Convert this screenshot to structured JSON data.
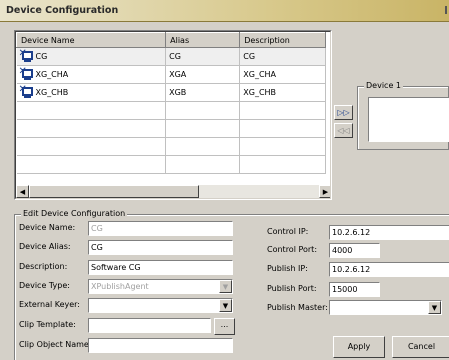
{
  "window": {
    "title": "Device Configuration"
  },
  "device_table": {
    "columns": [
      "Device Name",
      "Alias",
      "Description"
    ],
    "rows": [
      {
        "name": "CG",
        "alias": "CG",
        "description": "CG"
      },
      {
        "name": "XG_CHA",
        "alias": "XGA",
        "description": "XG_CHA"
      },
      {
        "name": "XG_CHB",
        "alias": "XGB",
        "description": "XG_CHB"
      }
    ]
  },
  "transfer": {
    "add_glyph": "▷▷",
    "remove_glyph": "◁◁"
  },
  "device1": {
    "label": "Device 1"
  },
  "edit": {
    "group_label": "Edit Device Configuration",
    "device_name_label": "Device Name:",
    "device_name_value": "CG",
    "device_alias_label": "Device Alias:",
    "device_alias_value": "CG",
    "description_label": "Description:",
    "description_value": "Software CG",
    "device_type_label": "Device Type:",
    "device_type_value": "XPublishAgent",
    "external_keyer_label": "External Keyer:",
    "external_keyer_value": "",
    "clip_template_label": "Clip Template:",
    "clip_template_value": "",
    "clip_template_browse": "...",
    "clip_object_name_label": "Clip Object Name:",
    "clip_object_name_value": "",
    "control_ip_label": "Control IP:",
    "control_ip_value": "10.2.6.12",
    "control_port_label": "Control Port:",
    "control_port_value": "4000",
    "publish_ip_label": "Publish IP:",
    "publish_ip_value": "10.2.6.12",
    "publish_port_label": "Publish Port:",
    "publish_port_value": "15000",
    "publish_master_label": "Publish Master:",
    "publish_master_value": ""
  },
  "buttons": {
    "apply": "Apply",
    "cancel": "Cancel"
  },
  "icons": {
    "combo_arrow": "chevron-down-icon",
    "device": "monitor-device-icon"
  }
}
